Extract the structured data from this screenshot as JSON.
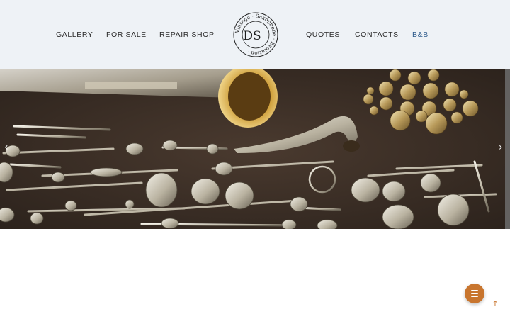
{
  "nav": {
    "left": [
      {
        "label": "GALLERY"
      },
      {
        "label": "FOR SALE"
      },
      {
        "label": "REPAIR SHOP"
      }
    ],
    "right": [
      {
        "label": "QUOTES"
      },
      {
        "label": "CONTACTS"
      },
      {
        "label": "B&B"
      }
    ]
  },
  "logo": {
    "ring_text": "Vintage · Saxophone · Evolution ·",
    "monogram": "DS"
  },
  "hero": {
    "image_subject": "disassembled vintage saxophone parts on a brown cloth",
    "prev_icon": "chevron-left-icon",
    "next_icon": "chevron-right-icon",
    "prev_glyph": "‹",
    "next_glyph": "›"
  },
  "fab": {
    "icon": "hamburger-menu-icon"
  },
  "to_top": {
    "icon": "arrow-up-icon",
    "glyph": "↑"
  },
  "colors": {
    "header_bg": "#eef2f6",
    "accent_nav": "#2f5c8c",
    "fab": "#c8752e",
    "hero_bg": "#3b2f27"
  }
}
